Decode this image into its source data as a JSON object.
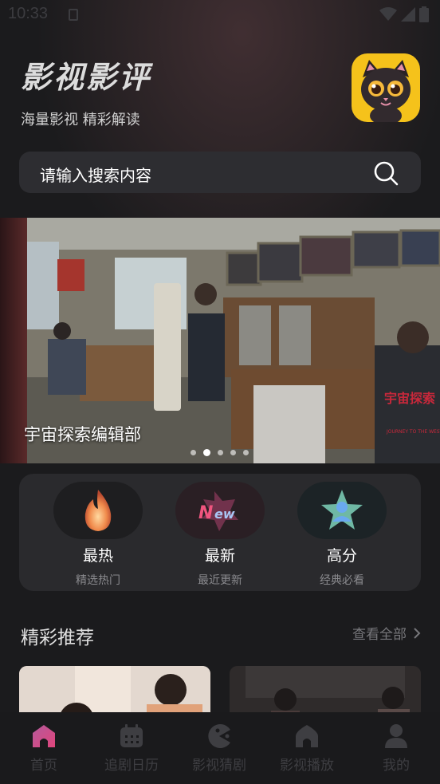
{
  "status_bar": {
    "time": "10:33"
  },
  "header": {
    "title": "影视影评",
    "subtitle": "海量影视 精彩解读"
  },
  "search": {
    "placeholder": "请输入搜索内容"
  },
  "banner": {
    "caption": "宇宙探索编辑部",
    "dots_count": 5,
    "active_index": 1,
    "poster_sign": "宇宙探索编辑部",
    "poster_logo": "宇宙探索编辑部 JOURNEY TO THE WEST"
  },
  "categories": [
    {
      "label": "最热",
      "sub": "精选热门",
      "icon": "flame-icon"
    },
    {
      "label": "最新",
      "sub": "最近更新",
      "icon": "new-badge-icon"
    },
    {
      "label": "高分",
      "sub": "经典必看",
      "icon": "star-person-icon"
    }
  ],
  "recommend": {
    "title": "精彩推荐",
    "view_all": "查看全部"
  },
  "tabs": [
    {
      "label": "首页",
      "icon": "home-icon",
      "active": true
    },
    {
      "label": "追剧日历",
      "icon": "calendar-icon"
    },
    {
      "label": "影视猜剧",
      "icon": "pacman-icon"
    },
    {
      "label": "影视播放",
      "icon": "house-play-icon"
    },
    {
      "label": "我的",
      "icon": "profile-icon"
    }
  ],
  "colors": {
    "background": "#1b1b1d",
    "panel": "#2a2a2d",
    "logo_yellow": "#f5c21b",
    "active_tab": "#e0457b"
  }
}
